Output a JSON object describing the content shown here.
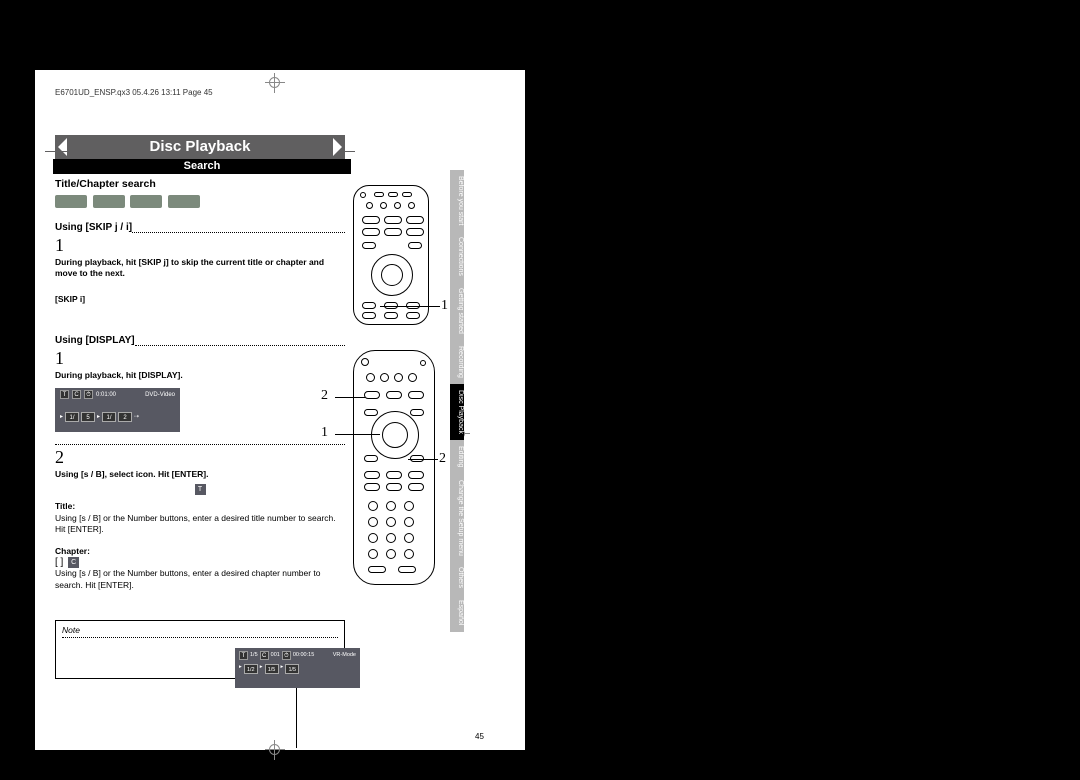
{
  "header": "E6701UD_ENSP.qx3  05.4.26  13:11  Page 45",
  "title_bar": "Disc Playback",
  "search_bar": "Search",
  "sub_heading": "Title/Chapter search",
  "using_skip_label": "Using [SKIP j / i]",
  "step_1": "1",
  "skip_text": "During playback, hit [SKIP j] to skip the current title or chapter and move to the next.",
  "skip_text2": "[SKIP i]",
  "using_display_label": "Using [DISPLAY]",
  "disp_step1": "1",
  "disp_step1_text": "During playback, hit [DISPLAY].",
  "osd_top": {
    "t_icon": "T",
    "c_icon": "C",
    "time": "0:01:00",
    "fmt": "DVD-Video"
  },
  "osd_body": {
    "v1": "1/",
    "v2": "5",
    "v3": "1/",
    "v4": "2",
    "arrow": "⇢"
  },
  "disp_step2": "2",
  "disp_step2_text": "Using [s / B], select      icon. Hit [ENTER].",
  "title_label": "Title:",
  "title_icon": "T",
  "title_text": "Using [s / B] or the Number buttons, enter a desired title number to search. Hit [ENTER].",
  "chapter_label": "Chapter:",
  "chapter_brackets": "[       ]",
  "chapter_icon": "C",
  "chapter_text": "Using [s / B] or the Number buttons, enter a desired chapter number to search. Hit [ENTER].",
  "note_label": "Note",
  "note_osd": {
    "row1": [
      "T",
      "1/5",
      "C",
      "001",
      "",
      "00:00:15",
      "VR-Mode"
    ],
    "row2": [
      "1/2",
      "1/5",
      "1/5"
    ]
  },
  "callouts": {
    "r1_1": "1",
    "r2_2t": "2",
    "r2_1": "1",
    "r2_2b": "2"
  },
  "tabs": [
    "Before you start",
    "Connections",
    "Getting started",
    "Recording",
    "Disc Playback",
    "Editing",
    "Change the Setup menu",
    "Others",
    "Español"
  ],
  "active_tab_index": 4,
  "page_number": "45"
}
